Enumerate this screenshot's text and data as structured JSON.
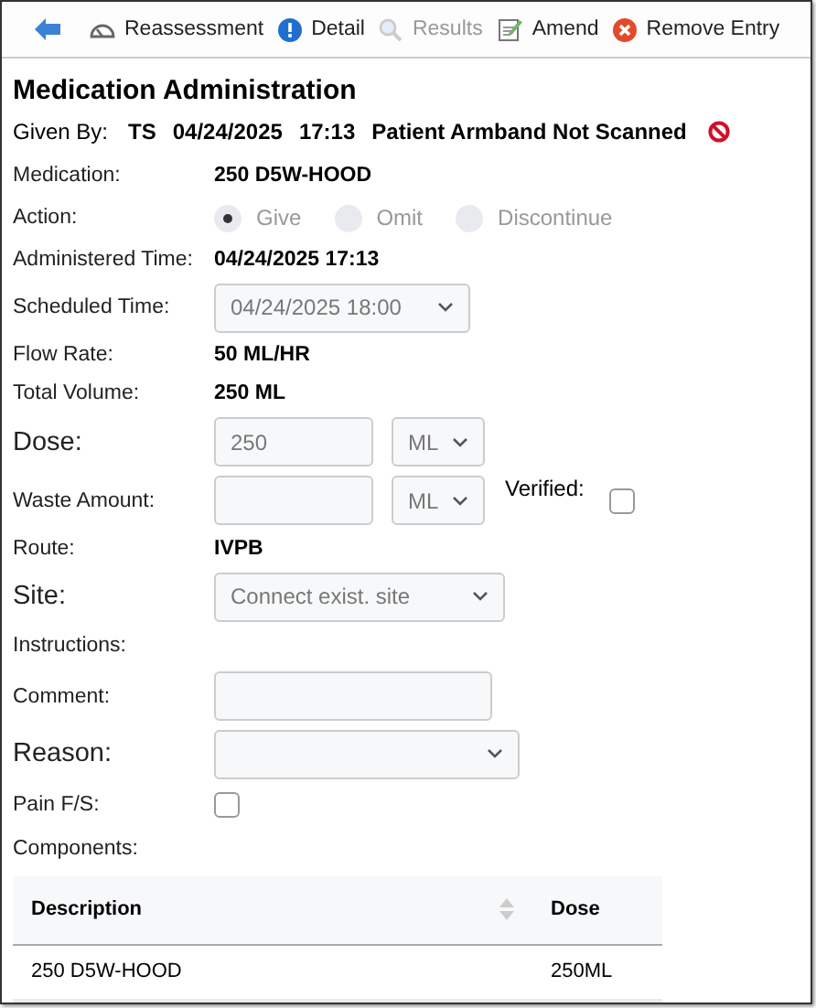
{
  "toolbar": [
    {
      "kind": "back",
      "disabled": false
    },
    {
      "kind": "gauge",
      "label": "Reassessment",
      "disabled": false
    },
    {
      "kind": "info",
      "label": "Detail",
      "disabled": false
    },
    {
      "kind": "search",
      "label": "Results",
      "disabled": true
    },
    {
      "kind": "edit",
      "label": "Amend",
      "disabled": false
    },
    {
      "kind": "remove",
      "label": "Remove Entry",
      "disabled": false
    }
  ],
  "title": "Medication Administration",
  "given_by": {
    "label": "Given By:",
    "values": [
      "TS",
      "04/24/2025",
      "17:13",
      "Patient Armband Not Scanned"
    ]
  },
  "rows": [
    {
      "kind": "text",
      "label": "Medication:",
      "value": "250 D5W-HOOD",
      "emphasized": false
    },
    {
      "kind": "radios",
      "label": "Action:",
      "emphasized": false,
      "disabled": true,
      "options": [
        {
          "label": "Give",
          "selected": true
        },
        {
          "label": "Omit",
          "selected": false
        },
        {
          "label": "Discontinue",
          "selected": false
        }
      ]
    },
    {
      "kind": "text",
      "label": "Administered Time:",
      "value": "04/24/2025 17:13",
      "emphasized": false
    },
    {
      "kind": "select",
      "label": "Scheduled Time:",
      "value": "04/24/2025 18:00",
      "emphasized": false
    },
    {
      "kind": "text",
      "label": "Flow Rate:",
      "value": "50 ML/HR",
      "emphasized": false
    },
    {
      "kind": "text",
      "label": "Total Volume:",
      "value": "250 ML",
      "emphasized": false
    },
    {
      "kind": "amount",
      "label": "Dose:",
      "value": "250",
      "unit": "ML",
      "emphasized": true
    },
    {
      "kind": "amount",
      "label": "Waste Amount:",
      "unit": "ML",
      "emphasized": false,
      "check_label": "Verified:",
      "checked": false
    },
    {
      "kind": "text",
      "label": "Route:",
      "value": "IVPB",
      "emphasized": false
    },
    {
      "kind": "select",
      "label": "Site:",
      "placeholder": "Connect exist. site",
      "emphasized": true
    },
    {
      "kind": "label",
      "label": "Instructions:",
      "emphasized": false
    },
    {
      "kind": "input",
      "label": "Comment:",
      "emphasized": false
    },
    {
      "kind": "wideselect",
      "label": "Reason:",
      "emphasized": true
    },
    {
      "kind": "checkbox",
      "label": "Pain F/S:",
      "checked": false,
      "emphasized": false
    },
    {
      "kind": "label",
      "label": "Components:",
      "emphasized": false
    }
  ],
  "table": {
    "columns": [
      "Description",
      "Dose"
    ],
    "rows": [
      [
        "250 D5W-HOOD",
        "250ML"
      ]
    ]
  }
}
